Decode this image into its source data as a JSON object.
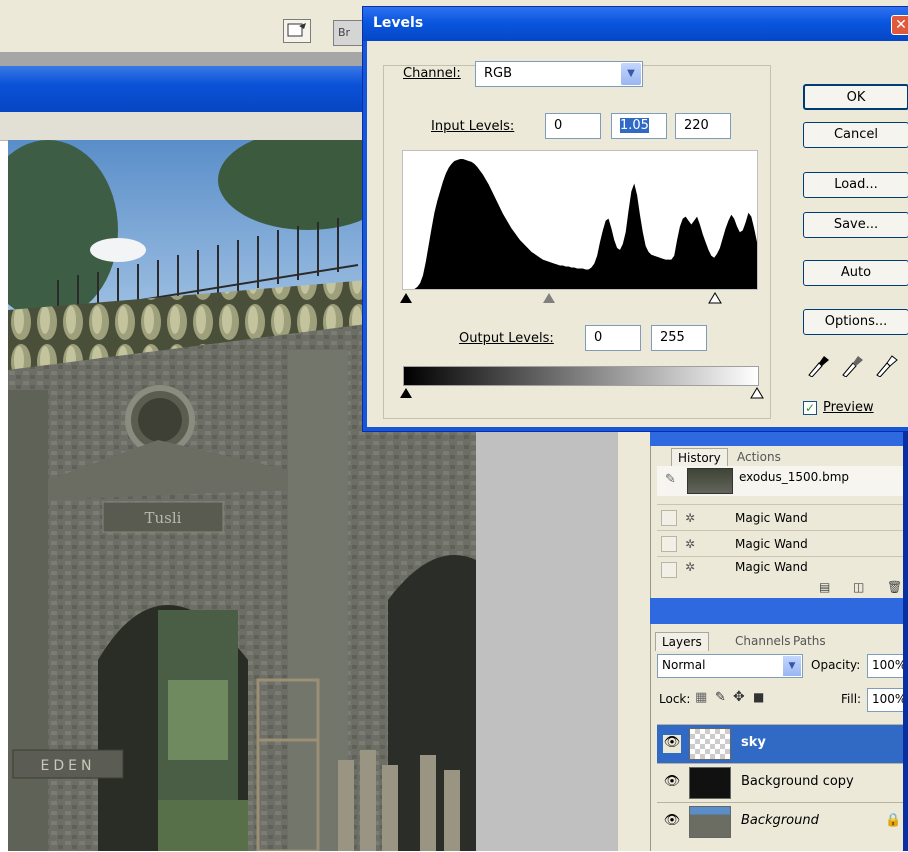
{
  "toolbar": {
    "browser_label": "Br"
  },
  "levels": {
    "title": "Levels",
    "close": "✕",
    "channel": {
      "label": "Channel:",
      "value": "RGB"
    },
    "input_levels": {
      "label": "Input Levels:",
      "black": "0",
      "gamma": "1.05",
      "white": "220"
    },
    "output_levels": {
      "label": "Output Levels:",
      "black": "0",
      "white": "255"
    },
    "buttons": {
      "ok": "OK",
      "cancel": "Cancel",
      "load": "Load...",
      "save": "Save...",
      "auto": "Auto",
      "options": "Options..."
    },
    "preview": {
      "label": "Preview",
      "checked": true
    },
    "histogram": [
      0,
      0,
      0,
      0,
      0,
      2,
      6,
      14,
      28,
      45,
      62,
      78,
      90,
      100,
      110,
      118,
      124,
      128,
      131,
      132,
      133,
      133,
      132,
      131,
      130,
      128,
      125,
      121,
      117,
      112,
      107,
      101,
      95,
      89,
      83,
      77,
      72,
      67,
      62,
      58,
      54,
      50,
      47,
      44,
      41,
      38,
      36,
      34,
      32,
      30,
      29,
      28,
      27,
      26,
      25,
      24,
      24,
      23,
      23,
      22,
      22,
      21,
      21,
      21,
      20,
      20,
      22,
      26,
      34,
      48,
      60,
      70,
      72,
      62,
      50,
      42,
      40,
      46,
      58,
      80,
      100,
      108,
      96,
      76,
      58,
      44,
      38,
      35,
      34,
      33,
      32,
      31,
      30,
      30,
      30,
      34,
      50,
      64,
      72,
      74,
      70,
      66,
      70,
      74,
      66,
      56,
      48,
      40,
      34,
      32,
      36,
      42,
      52,
      62,
      70,
      76,
      72,
      64,
      58,
      60,
      68,
      78,
      74,
      62,
      48
    ]
  },
  "history": {
    "tabs": [
      "History",
      "Actions"
    ],
    "snapshot": "exodus_1500.bmp",
    "items": [
      "Magic Wand",
      "Magic Wand",
      "Magic Wand"
    ]
  },
  "layers": {
    "tabs": [
      "Layers",
      "Channels",
      "Paths"
    ],
    "blend_mode": "Normal",
    "opacity_label": "Opacity:",
    "opacity": "100%",
    "lock_label": "Lock:",
    "fill_label": "Fill:",
    "fill": "100%",
    "items": [
      {
        "name": "sky",
        "selected": true
      },
      {
        "name": "Background copy",
        "selected": false
      },
      {
        "name": "Background",
        "selected": false,
        "locked": true
      }
    ]
  },
  "canvas": {
    "sign_text": "EDEN",
    "plaque_text": "Tusli"
  },
  "colors": {
    "dialog_title": "#0a56de",
    "selected_layer": "#316ac5",
    "dialog_bg": "#ece9d8"
  }
}
